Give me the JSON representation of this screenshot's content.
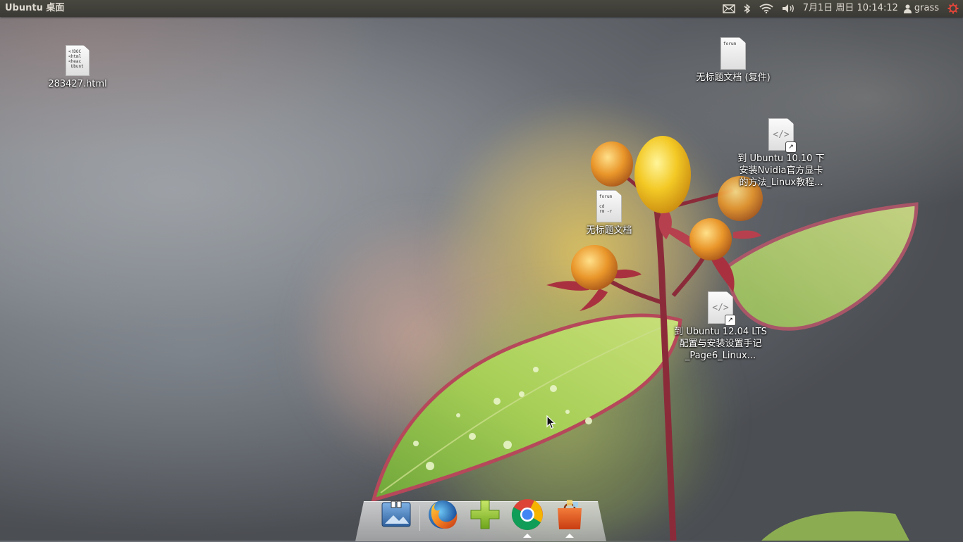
{
  "panel": {
    "title": "Ubuntu 桌面",
    "clock": "7月1日 周日 10:14:12",
    "user": "grass"
  },
  "desktop_icons": [
    {
      "label": "283427.html",
      "preview": "<!DOC\n<html\n<heac\n Ubunt"
    },
    {
      "label": "无标题文档 (复件)",
      "preview": "forum"
    },
    {
      "label_lines": [
        "到 Ubuntu 10.10 下",
        "安装Nvidia官方显卡",
        "的方法_Linux教程..."
      ]
    },
    {
      "label": "无标题文档",
      "preview": "forum\n\ncd\nrm -r"
    },
    {
      "label_lines": [
        "到 Ubuntu 12.04 LTS",
        "配置与安装设置手记",
        "_Page6_Linux..."
      ]
    }
  ],
  "dock": {
    "items": [
      "desktop-switcher",
      "firefox",
      "add-application",
      "chrome",
      "software-center"
    ]
  },
  "colors": {
    "panel_bg": "#3c3b37",
    "panel_text": "#dfdbd2"
  }
}
